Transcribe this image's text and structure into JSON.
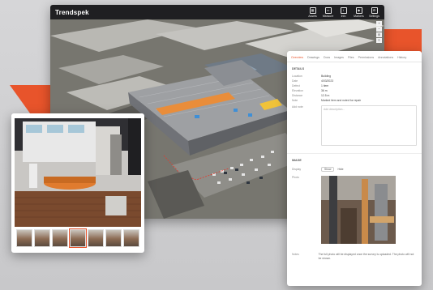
{
  "app": {
    "logo_text": "Trendspek",
    "nav": [
      {
        "label": "Assets",
        "icon": "grid-icon"
      },
      {
        "label": "Measure",
        "icon": "ruler-icon"
      },
      {
        "label": "Info",
        "icon": "info-icon"
      },
      {
        "label": "Markers",
        "icon": "marker-icon"
      },
      {
        "label": "Settings",
        "icon": "gear-icon"
      }
    ]
  },
  "panel": {
    "tabs": [
      "Overview",
      "Drawings",
      "Docs",
      "Images",
      "Files",
      "Permissions",
      "Annotations",
      "History"
    ],
    "active_tab": 0,
    "section_title": "DETAILS",
    "fields": [
      {
        "k": "Location",
        "v": "Building"
      },
      {
        "k": "Date",
        "v": "4/03/2023"
      },
      {
        "k": "Defect",
        "v": "1 item"
      },
      {
        "k": "Elevation",
        "v": "36 m"
      },
      {
        "k": "Distance",
        "v": "12.5 m"
      },
      {
        "k": "Note",
        "v": "Marked item and noted for repair"
      }
    ],
    "notes_label": "Add note",
    "notes_placeholder": "Add description...",
    "image_section": "IMAGE",
    "image_mode_label": "Display",
    "image_mode_options": [
      "Show",
      "Hide"
    ],
    "image_label": "Photo",
    "footer_label": "Notes",
    "footer_text": "The full photo will be displayed once the survey is uploaded. The photo will not be shown."
  },
  "colors": {
    "accent": "#e8542b",
    "topbar": "#1f1f22"
  }
}
